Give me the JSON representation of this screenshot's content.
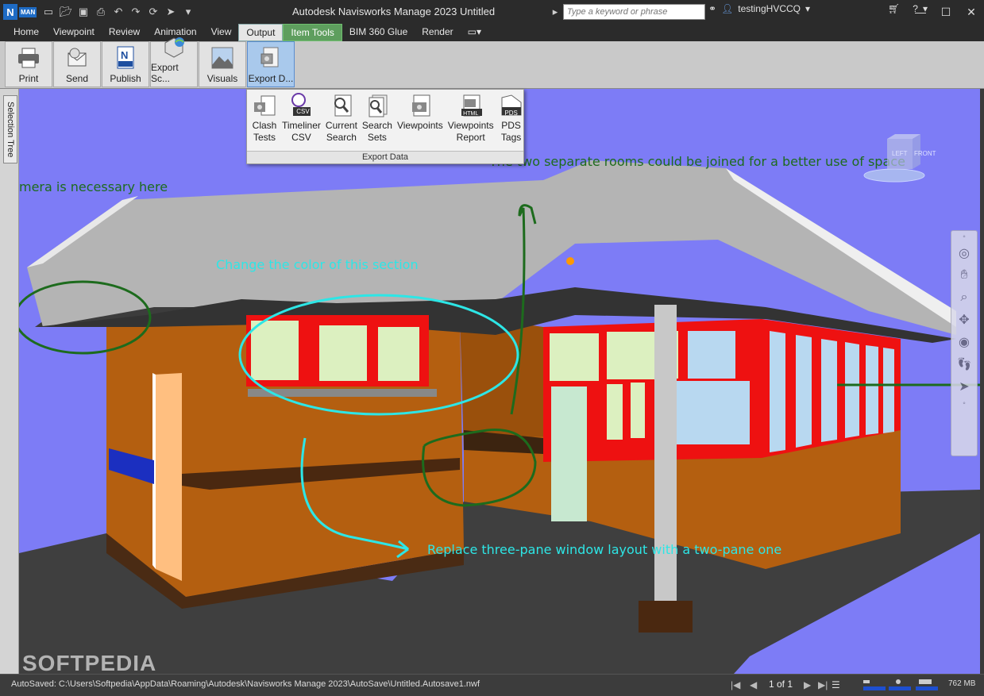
{
  "window": {
    "title": "Autodesk Navisworks Manage 2023   Untitled",
    "logo_letter": "N",
    "logo_tag": "MAN",
    "search_placeholder": "Type a keyword or phrase",
    "user": "testingHVCCQ"
  },
  "tabs": [
    "Home",
    "Viewpoint",
    "Review",
    "Animation",
    "View",
    "Output",
    "Item Tools",
    "BIM 360 Glue",
    "Render"
  ],
  "active_tab": "Output",
  "ribbon": {
    "buttons": [
      "Print",
      "Send",
      "Publish",
      "Export Sc...",
      "Visuals",
      "Export D..."
    ]
  },
  "export_data": {
    "items": [
      {
        "line1": "Clash",
        "line2": "Tests"
      },
      {
        "line1": "Timeliner",
        "line2": "CSV"
      },
      {
        "line1": "Current",
        "line2": "Search"
      },
      {
        "line1": "Search",
        "line2": "Sets"
      },
      {
        "line1": "Viewpoints",
        "line2": ""
      },
      {
        "line1": "Viewpoints",
        "line2": "Report"
      },
      {
        "line1": "PDS",
        "line2": "Tags"
      }
    ],
    "footer": "Export Data",
    "icon_tags": {
      "csv": "CSV",
      "html": "HTML",
      "pds": "PDS"
    }
  },
  "sidebar": {
    "selection_tree": "Selection Tree"
  },
  "viewport": {
    "background": "#7d7cf6",
    "annotations": [
      {
        "text": "mera is necessary here",
        "color": "green"
      },
      {
        "text": "The two separate rooms could be joined for a better use of space",
        "color": "green"
      },
      {
        "text": "Change the color of this section",
        "color": "cyan"
      },
      {
        "text": "Replace three-pane window layout with a two-pane one",
        "color": "cyan"
      }
    ],
    "viewcube_left": "LEFT",
    "viewcube_front": "FRONT",
    "watermark": "SOFTPEDIA"
  },
  "status": {
    "path": "AutoSaved: C:\\Users\\Softpedia\\AppData\\Roaming\\Autodesk\\Navisworks Manage 2023\\AutoSave\\Untitled.Autosave1.nwf",
    "page": "1 of 1",
    "memory": "762 MB"
  }
}
